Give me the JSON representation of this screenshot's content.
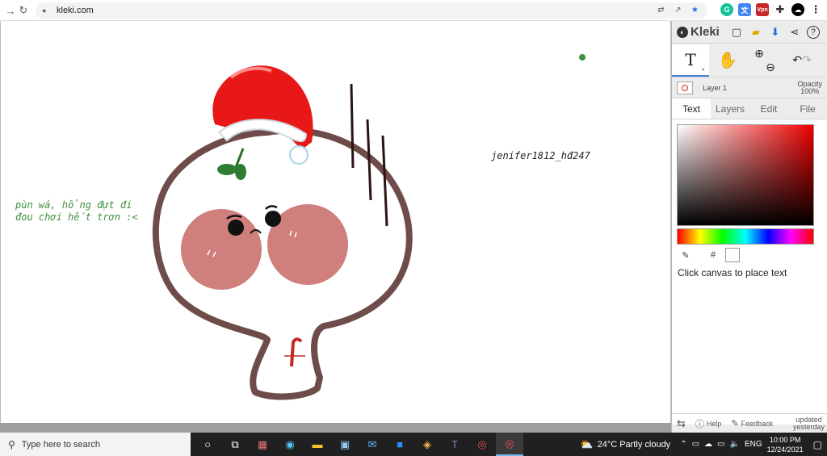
{
  "browser": {
    "url": "kleki.com",
    "back_glyph": "→",
    "reload_glyph": "↻",
    "lock_glyph": "🔒"
  },
  "canvas": {
    "signature": "jenifer1812_hđ247",
    "caption_line1": "pùn wá, hổng đựt đi",
    "caption_line2": "đou chơi hết trơn :<",
    "caption_color": "#3f8f3f"
  },
  "panel": {
    "app_name": "Kleki",
    "layer_name": "Layer 1",
    "opacity_label": "Opacity",
    "opacity_value": "100%",
    "tabs": [
      "Text",
      "Layers",
      "Edit",
      "File"
    ],
    "active_tab": "Text",
    "hex_label": "#",
    "hint": "Click canvas to place text",
    "footer": {
      "help": "Help",
      "feedback": "Feedback",
      "updated_line1": "updated",
      "updated_line2": "yesterday"
    }
  },
  "taskbar": {
    "search_placeholder": "Type here to search",
    "weather": "24°C  Partly cloudy",
    "lang": "ENG",
    "time": "10:00 PM",
    "date": "12/24/2021"
  }
}
